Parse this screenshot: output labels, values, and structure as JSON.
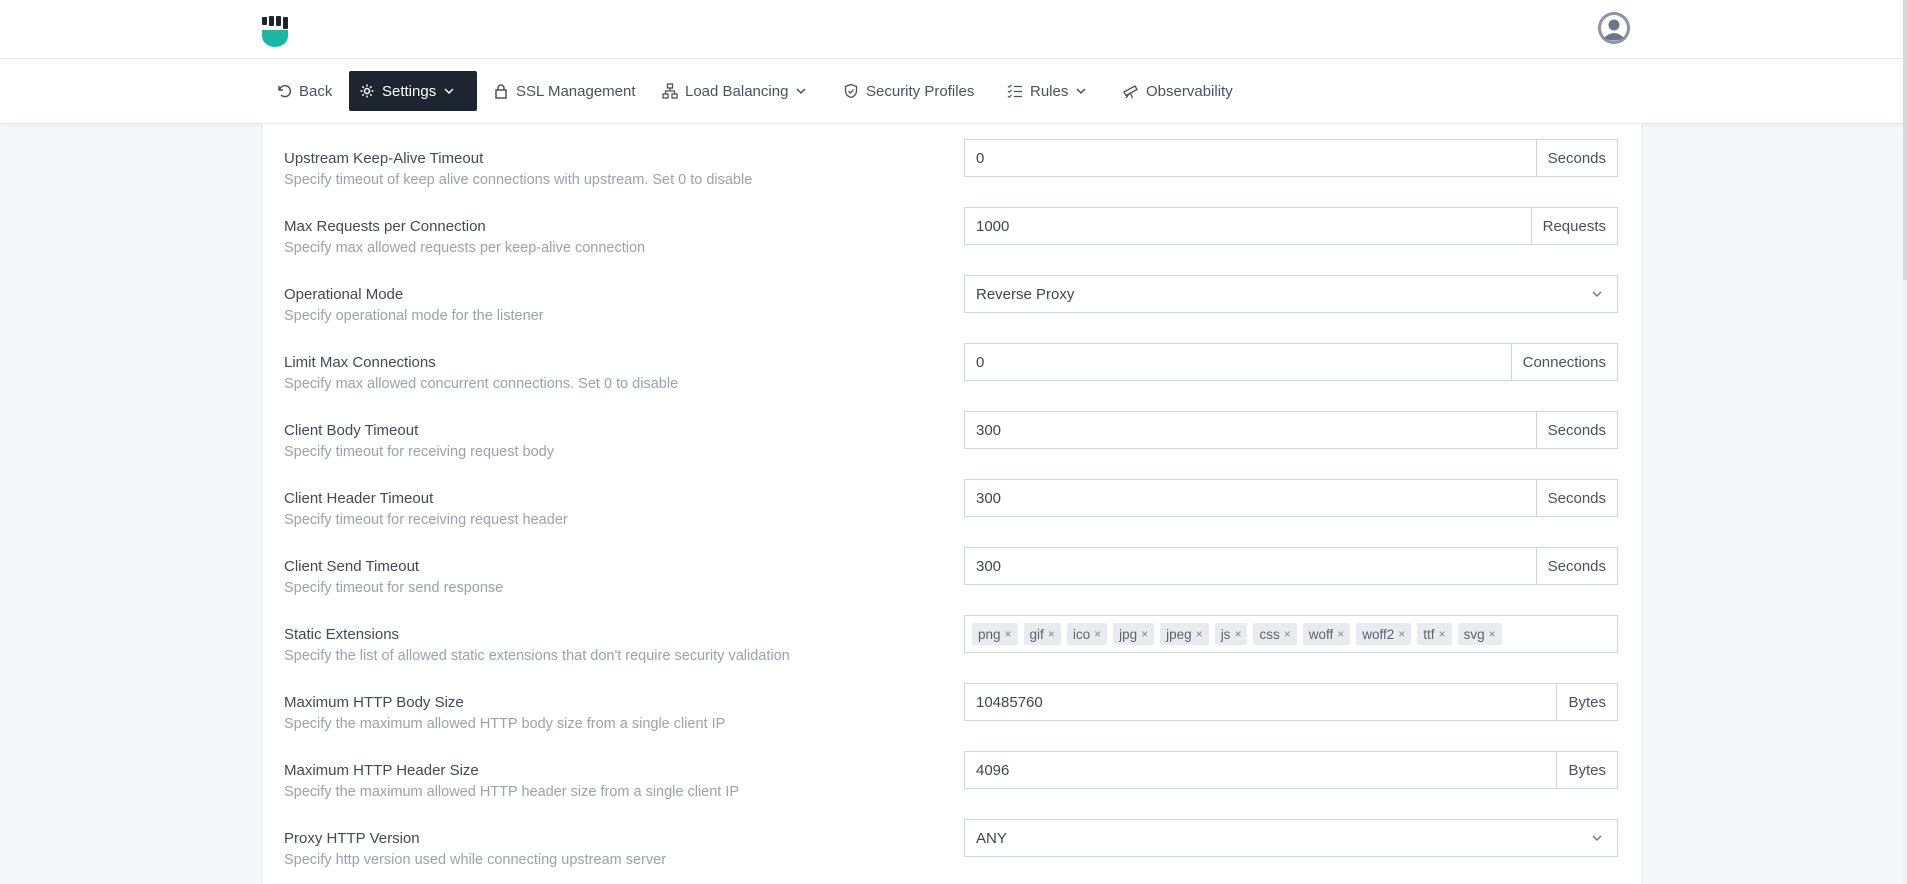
{
  "header": {
    "logo_name": "fist-logo",
    "avatar_name": "user-avatar"
  },
  "nav": [
    {
      "label": "Back",
      "icon": "undo-icon"
    },
    {
      "label": "Settings",
      "icon": "gear-icon",
      "active": true,
      "dropdown": true
    },
    {
      "label": "SSL Management",
      "icon": "lock-icon"
    },
    {
      "label": "Load Balancing",
      "icon": "network-icon",
      "dropdown": true
    },
    {
      "label": "Security Profiles",
      "icon": "shield-icon"
    },
    {
      "label": "Rules",
      "icon": "list-check-icon",
      "dropdown": true
    },
    {
      "label": "Observability",
      "icon": "telescope-icon"
    }
  ],
  "settings": [
    {
      "label": "Upstream Keep-Alive Timeout",
      "desc": "Specify timeout of keep alive connections with upstream. Set 0 to disable",
      "value": "0",
      "unit": "Seconds"
    },
    {
      "label": "Max Requests per Connection",
      "desc": "Specify max allowed requests per keep-alive connection",
      "value": "1000",
      "unit": "Requests"
    },
    {
      "label": "Operational Mode",
      "desc": "Specify operational mode for the listener",
      "value": "Reverse Proxy"
    },
    {
      "label": "Limit Max Connections",
      "desc": "Specify max allowed concurrent connections. Set 0 to disable",
      "value": "0",
      "unit": "Connections"
    },
    {
      "label": "Client Body Timeout",
      "desc": "Specify timeout for receiving request body",
      "value": "300",
      "unit": "Seconds"
    },
    {
      "label": "Client Header Timeout",
      "desc": "Specify timeout for receiving request header",
      "value": "300",
      "unit": "Seconds"
    },
    {
      "label": "Client Send Timeout",
      "desc": "Specify timeout for send response",
      "value": "300",
      "unit": "Seconds"
    },
    {
      "label": "Static Extensions",
      "desc": "Specify the list of allowed static extensions that don't require security validation",
      "tags": [
        "png",
        "gif",
        "ico",
        "jpg",
        "jpeg",
        "js",
        "css",
        "woff",
        "woff2",
        "ttf",
        "svg"
      ],
      "tag_remove": "×"
    },
    {
      "label": "Maximum HTTP Body Size",
      "desc": "Specify the maximum allowed HTTP body size from a single client IP",
      "value": "10485760",
      "unit": "Bytes"
    },
    {
      "label": "Maximum HTTP Header Size",
      "desc": "Specify the maximum allowed HTTP header size from a single client IP",
      "value": "4096",
      "unit": "Bytes"
    },
    {
      "label": "Proxy HTTP Version",
      "desc": "Specify http version used while connecting upstream server",
      "value": "ANY"
    }
  ],
  "colors": {
    "active_nav_bg": "#1d2530",
    "brand": "#1fb5a3",
    "page_bg": "#f6f7f9"
  }
}
